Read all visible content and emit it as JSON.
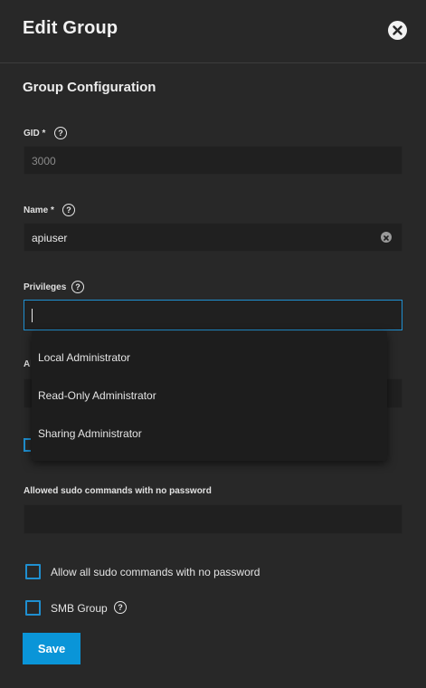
{
  "header": {
    "title": "Edit Group",
    "close_icon": "close-icon"
  },
  "section": {
    "title": "Group Configuration"
  },
  "gid": {
    "label": "GID *",
    "value": "3000"
  },
  "name": {
    "label": "Name *",
    "value": "apiuser"
  },
  "privileges": {
    "label": "Privileges",
    "value": "",
    "options": [
      "Local Administrator",
      "Read-Only Administrator",
      "Sharing Administrator"
    ]
  },
  "sudo_nopass": {
    "label": "Allowed sudo commands with no password",
    "value": ""
  },
  "checkboxes": {
    "allow_all_sudo_nopass": "Allow all sudo commands with no password",
    "smb_group": "SMB Group"
  },
  "save_label": "Save",
  "colors": {
    "accent": "#0a95d8",
    "background": "#282828",
    "field": "#202020"
  }
}
